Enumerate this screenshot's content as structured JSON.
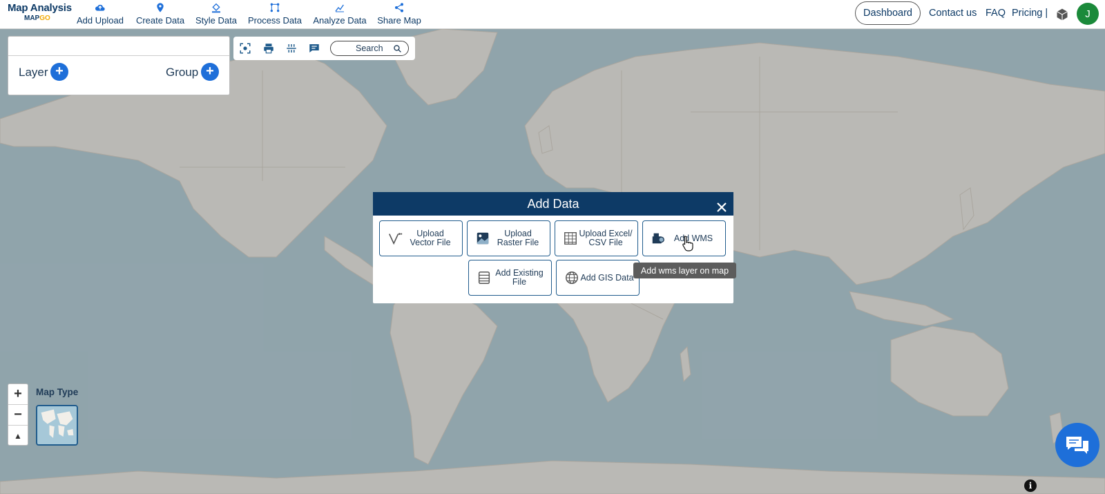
{
  "app": {
    "brand_title": "Map Analysis",
    "brand_sub_a": "MAP",
    "brand_sub_b": "GO"
  },
  "nav": [
    {
      "label": "Add Upload",
      "icon": "cloud-upload-icon"
    },
    {
      "label": "Create Data",
      "icon": "map-pin-icon"
    },
    {
      "label": "Style Data",
      "icon": "paint-bucket-icon"
    },
    {
      "label": "Process Data",
      "icon": "process-nodes-icon"
    },
    {
      "label": "Analyze Data",
      "icon": "analyze-chart-icon"
    },
    {
      "label": "Share Map",
      "icon": "share-icon"
    }
  ],
  "right_nav": {
    "dashboard": "Dashboard",
    "contact": "Contact us",
    "faq": "FAQ",
    "pricing": "Pricing |",
    "avatar_initial": "J"
  },
  "layer_panel": {
    "layer_label": "Layer",
    "group_label": "Group",
    "plus": "+"
  },
  "toolbar": {
    "search_label": "Search",
    "tools": [
      "fit-extent-icon",
      "print-icon",
      "measure-icon",
      "comment-icon"
    ]
  },
  "map_controls": {
    "zoom_in": "+",
    "zoom_out": "−",
    "reset_north": "▲",
    "map_type_label": "Map Type"
  },
  "modal": {
    "title": "Add Data",
    "options": [
      {
        "line1": "Upload",
        "line2": "Vector File",
        "icon": "vector-icon"
      },
      {
        "line1": "Upload",
        "line2": "Raster File",
        "icon": "raster-image-icon"
      },
      {
        "line1": "Upload Excel/",
        "line2": "CSV File",
        "icon": "spreadsheet-icon"
      },
      {
        "line1": "Add WMS",
        "line2": "",
        "icon": "wms-icon"
      },
      {
        "line1": "Add Existing",
        "line2": "File",
        "icon": "database-icon"
      },
      {
        "line1": "Add GIS Data",
        "line2": "",
        "icon": "globe-icon"
      }
    ],
    "tooltip": "Add wms layer on map"
  },
  "info": "i",
  "colors": {
    "primary": "#0d3a66",
    "accent_blue": "#1e6fd9",
    "avatar_green": "#1b8a3a",
    "ocean": "#aacbd8",
    "land": "#f2efe9"
  }
}
